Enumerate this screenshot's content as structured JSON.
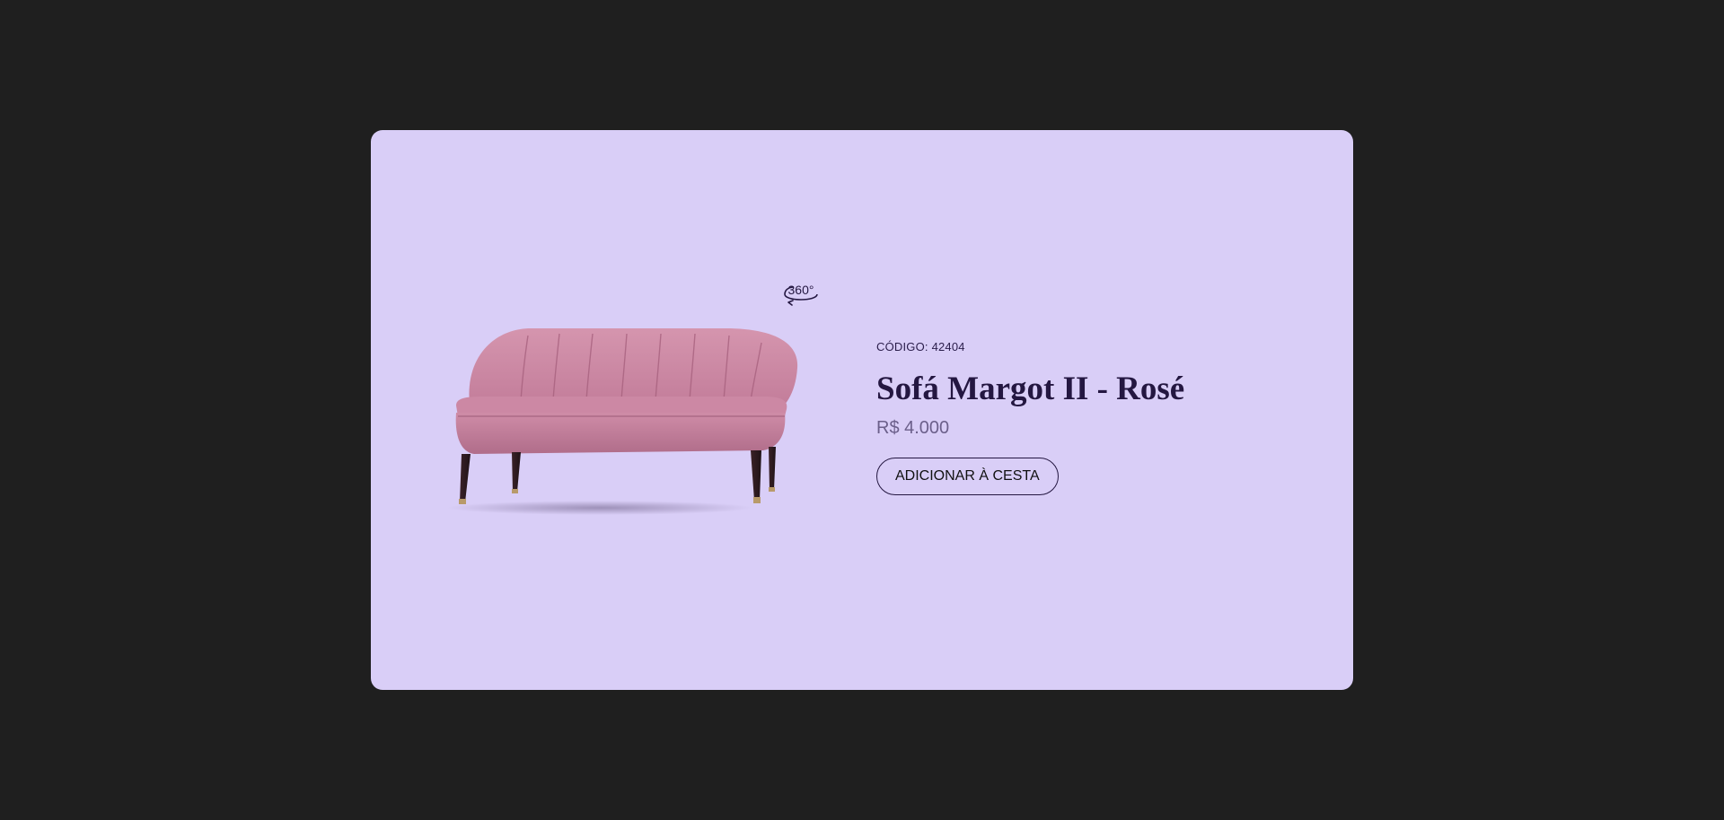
{
  "product": {
    "code_label": "CÓDIGO:",
    "code_value": "42404",
    "name": "Sofá Margot II - Rosé",
    "price": "R$ 4.000",
    "add_to_cart_label": "ADICIONAR À CESTA",
    "view_360_label": "360°",
    "image_alt": "sofa-image"
  },
  "colors": {
    "page_background": "#1f1f1f",
    "card_background": "#d9cef7",
    "title": "#241741",
    "price": "#6b5f8a",
    "sofa_fabric": "#c9849f",
    "sofa_legs": "#2a1a1f"
  },
  "icons": {
    "view_360": "rotate-360-icon"
  }
}
